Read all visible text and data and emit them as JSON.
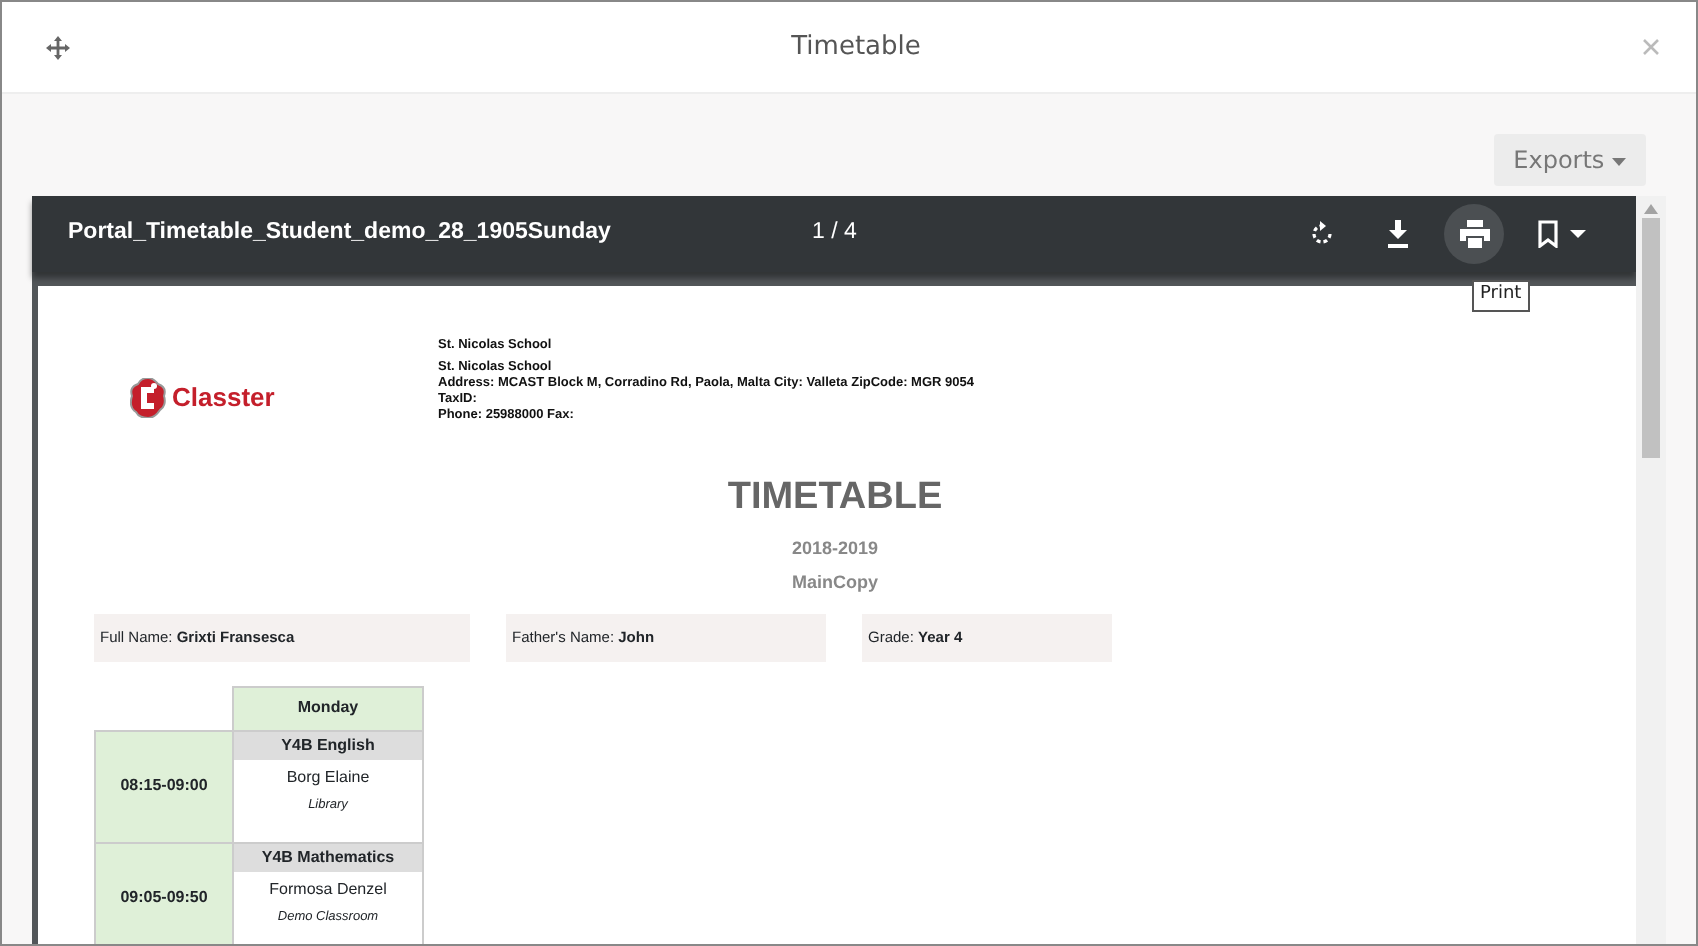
{
  "dialog": {
    "title": "Timetable"
  },
  "exports_button": {
    "label": "Exports"
  },
  "viewer": {
    "filename": "Portal_Timetable_Student_demo_28_1905Sunday",
    "page_indicator": "1 / 4",
    "tooltip": "Print"
  },
  "document": {
    "logo_text": "Classter",
    "header_lines": [
      "St. Nicolas School",
      "St. Nicolas School",
      "Address: MCAST Block M, Corradino Rd, Paola, Malta  City: Valleta ZipCode: MGR 9054",
      "TaxID:",
      "Phone: 25988000 Fax:"
    ],
    "title": "TIMETABLE",
    "year": "2018-2019",
    "copy": "MainCopy",
    "info_fields": [
      {
        "text": "Full Name: **Grixti Fransesca**"
      },
      {
        "text": "Father's Name: **John**"
      },
      {
        "text": "Grade: **Year 4**"
      }
    ],
    "timetable": {
      "day": "Monday",
      "slots": [
        {
          "time": "08:15-09:00",
          "subject": "Y4B English",
          "teacher": "Borg Elaine",
          "room": "Library"
        },
        {
          "time": "09:05-09:50",
          "subject": "Y4B Mathematics",
          "teacher": "Formosa Denzel",
          "room": "Demo Classroom"
        }
      ]
    }
  }
}
